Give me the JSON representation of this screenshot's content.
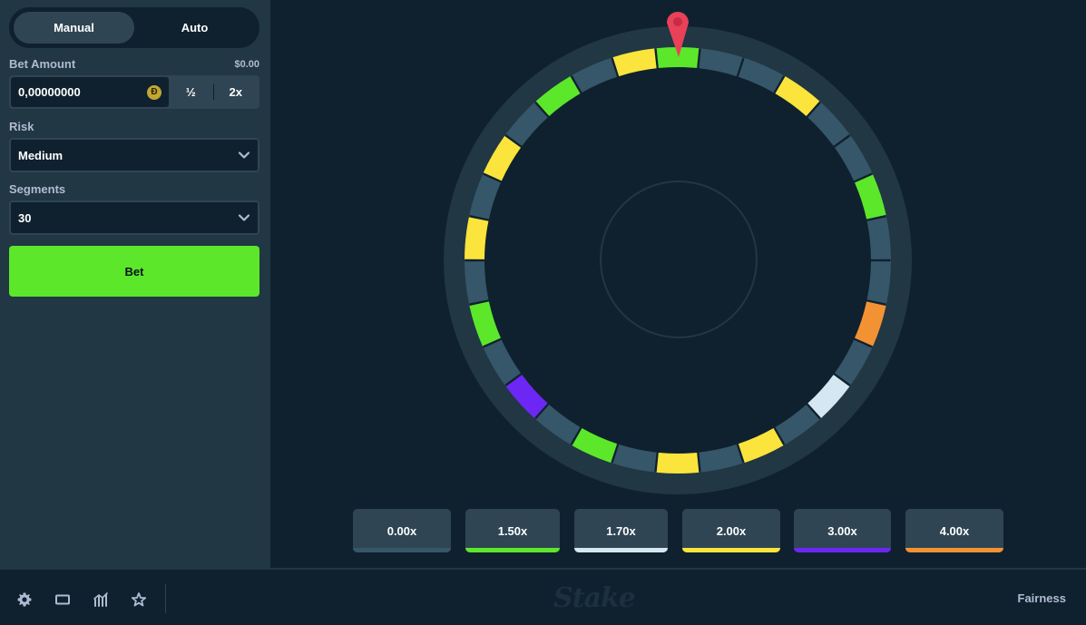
{
  "sidebar": {
    "tabs": [
      {
        "label": "Manual",
        "active": true
      },
      {
        "label": "Auto",
        "active": false
      }
    ],
    "bet_amount": {
      "label": "Bet Amount",
      "usd_value": "$0.00",
      "value": "0,00000000",
      "coin_symbol": "Ð",
      "half_label": "½",
      "double_label": "2x"
    },
    "risk": {
      "label": "Risk",
      "value": "Medium"
    },
    "segments": {
      "label": "Segments",
      "value": "30"
    },
    "bet_button_label": "Bet"
  },
  "wheel": {
    "segment_count": 30,
    "segments": [
      "green",
      "dark",
      "dark",
      "yellow",
      "dark",
      "dark",
      "green",
      "dark",
      "dark",
      "orange",
      "dark",
      "lightblue",
      "dark",
      "yellow",
      "dark",
      "yellow",
      "dark",
      "green",
      "dark",
      "purple",
      "dark",
      "green",
      "dark",
      "yellow",
      "dark",
      "yellow",
      "dark",
      "green",
      "dark",
      "yellow"
    ],
    "colors": {
      "dark": "#365669",
      "green": "#5ce72b",
      "yellow": "#fbe43c",
      "orange": "#f39233",
      "lightblue": "#d5e8f2",
      "purple": "#6d27f5",
      "pointer": "#e9415a",
      "ring": "#213743"
    }
  },
  "multipliers": [
    {
      "label": "0.00x",
      "color": "#365669"
    },
    {
      "label": "1.50x",
      "color": "#5ce72b"
    },
    {
      "label": "1.70x",
      "color": "#d5e8f2"
    },
    {
      "label": "2.00x",
      "color": "#fbe43c"
    },
    {
      "label": "3.00x",
      "color": "#6d27f5"
    },
    {
      "label": "4.00x",
      "color": "#f39233"
    }
  ],
  "footer": {
    "icons": [
      "gear-icon",
      "theatre-mode-icon",
      "stats-icon",
      "star-icon"
    ],
    "logo": "Stake",
    "fairness_label": "Fairness"
  }
}
